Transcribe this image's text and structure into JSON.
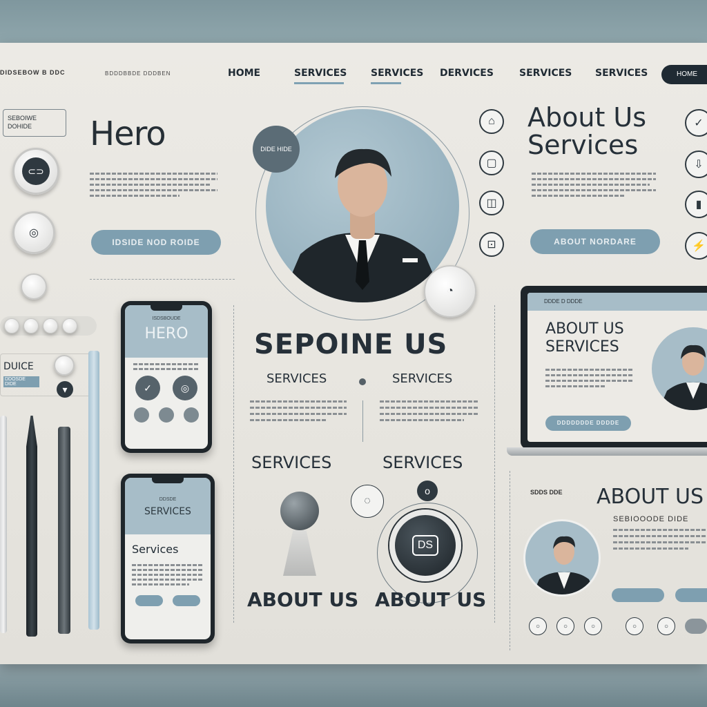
{
  "nav": {
    "brand": "DIDSEBOW B DDC",
    "tiny": "BDDDBBDE DDDBEN",
    "items": [
      "HOME",
      "SERVICES",
      "SERVICES",
      "DERVICES",
      "SERVICES",
      "SERVICES"
    ],
    "cta": "HOME"
  },
  "hero": {
    "badge_line1": "SEBOIWE",
    "badge_line2": "DOHIDE",
    "title": "Hero",
    "button": "IDSIDE NOD ROIDE"
  },
  "portrait": {
    "badge": "DIDE HIDE"
  },
  "about": {
    "title_line1": "About Us",
    "title_line2": "Services",
    "button": "ABOUT NORDARE"
  },
  "middle": {
    "heading": "SEPOINE US",
    "col1_label": "SERVICES",
    "col2_label": "SERVICES",
    "big_label1": "SERVICES",
    "big_label2": "SERVICES",
    "about1": "ABOUT US",
    "about2": "ABOUT US",
    "knob_label": "DS"
  },
  "phone1": {
    "top": "ISDSBOUDE",
    "title": "HERO"
  },
  "phone2": {
    "top": "DDSDE",
    "header": "SERVICES",
    "title": "Services"
  },
  "laptop": {
    "top": "DDDE D DDDE",
    "title_line1": "ABOUT US",
    "title_line2": "SERVICES",
    "button": "DDDDDDDE DDDDE"
  },
  "left_misc": {
    "label1": "DUICE",
    "label2": "DDOSDE DIDE"
  },
  "bottom_right": {
    "small_label": "SDDS DDE",
    "title": "ABOUT US",
    "sub": "SEBIOOODE DIDE"
  },
  "icons": {
    "colors": {
      "accent": "#7e9fb0",
      "dark": "#1f2a33",
      "board": "#eceae5"
    }
  }
}
